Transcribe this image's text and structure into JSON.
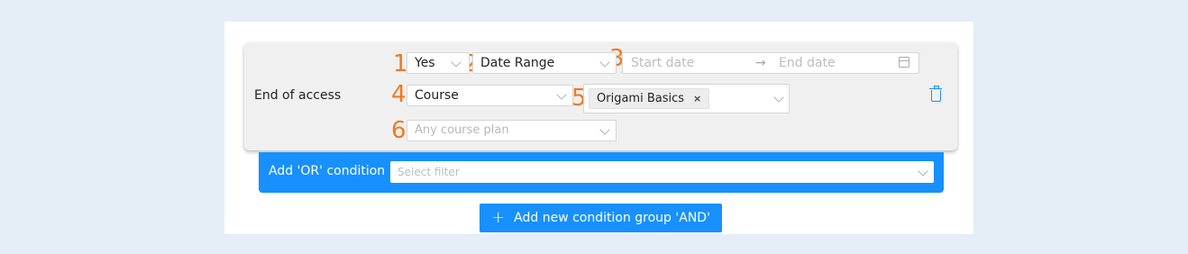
{
  "numbers": [
    "1",
    "2",
    "3",
    "4",
    "5",
    "6"
  ],
  "condition": {
    "label": "End of access",
    "yes_no": "Yes",
    "range_type": "Date Range",
    "start_placeholder": "Start date",
    "arrow": "→",
    "end_placeholder": "End date",
    "target": "Course",
    "selected_tag": "Origami Basics",
    "tag_remove": "×",
    "plan_placeholder": "Any course plan"
  },
  "or_condition": {
    "label": "Add 'OR' condition",
    "placeholder": "Select filter"
  },
  "add_group_button": {
    "icon": "+",
    "label": "Add new condition group 'AND'"
  },
  "colors": {
    "accent": "#1890ff",
    "marker": "#ef7a23"
  },
  "icons": [
    "chevron-down-icon",
    "calendar-icon",
    "trash-icon",
    "plus-icon",
    "close-icon"
  ]
}
